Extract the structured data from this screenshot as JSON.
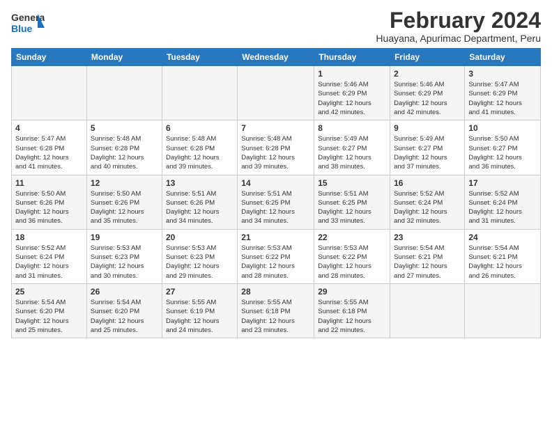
{
  "logo": {
    "line1": "General",
    "line2": "Blue"
  },
  "title": "February 2024",
  "location": "Huayana, Apurimac Department, Peru",
  "days_of_week": [
    "Sunday",
    "Monday",
    "Tuesday",
    "Wednesday",
    "Thursday",
    "Friday",
    "Saturday"
  ],
  "weeks": [
    [
      {
        "day": "",
        "info": ""
      },
      {
        "day": "",
        "info": ""
      },
      {
        "day": "",
        "info": ""
      },
      {
        "day": "",
        "info": ""
      },
      {
        "day": "1",
        "info": "Sunrise: 5:46 AM\nSunset: 6:29 PM\nDaylight: 12 hours\nand 42 minutes."
      },
      {
        "day": "2",
        "info": "Sunrise: 5:46 AM\nSunset: 6:29 PM\nDaylight: 12 hours\nand 42 minutes."
      },
      {
        "day": "3",
        "info": "Sunrise: 5:47 AM\nSunset: 6:29 PM\nDaylight: 12 hours\nand 41 minutes."
      }
    ],
    [
      {
        "day": "4",
        "info": "Sunrise: 5:47 AM\nSunset: 6:28 PM\nDaylight: 12 hours\nand 41 minutes."
      },
      {
        "day": "5",
        "info": "Sunrise: 5:48 AM\nSunset: 6:28 PM\nDaylight: 12 hours\nand 40 minutes."
      },
      {
        "day": "6",
        "info": "Sunrise: 5:48 AM\nSunset: 6:28 PM\nDaylight: 12 hours\nand 39 minutes."
      },
      {
        "day": "7",
        "info": "Sunrise: 5:48 AM\nSunset: 6:28 PM\nDaylight: 12 hours\nand 39 minutes."
      },
      {
        "day": "8",
        "info": "Sunrise: 5:49 AM\nSunset: 6:27 PM\nDaylight: 12 hours\nand 38 minutes."
      },
      {
        "day": "9",
        "info": "Sunrise: 5:49 AM\nSunset: 6:27 PM\nDaylight: 12 hours\nand 37 minutes."
      },
      {
        "day": "10",
        "info": "Sunrise: 5:50 AM\nSunset: 6:27 PM\nDaylight: 12 hours\nand 36 minutes."
      }
    ],
    [
      {
        "day": "11",
        "info": "Sunrise: 5:50 AM\nSunset: 6:26 PM\nDaylight: 12 hours\nand 36 minutes."
      },
      {
        "day": "12",
        "info": "Sunrise: 5:50 AM\nSunset: 6:26 PM\nDaylight: 12 hours\nand 35 minutes."
      },
      {
        "day": "13",
        "info": "Sunrise: 5:51 AM\nSunset: 6:26 PM\nDaylight: 12 hours\nand 34 minutes."
      },
      {
        "day": "14",
        "info": "Sunrise: 5:51 AM\nSunset: 6:25 PM\nDaylight: 12 hours\nand 34 minutes."
      },
      {
        "day": "15",
        "info": "Sunrise: 5:51 AM\nSunset: 6:25 PM\nDaylight: 12 hours\nand 33 minutes."
      },
      {
        "day": "16",
        "info": "Sunrise: 5:52 AM\nSunset: 6:24 PM\nDaylight: 12 hours\nand 32 minutes."
      },
      {
        "day": "17",
        "info": "Sunrise: 5:52 AM\nSunset: 6:24 PM\nDaylight: 12 hours\nand 31 minutes."
      }
    ],
    [
      {
        "day": "18",
        "info": "Sunrise: 5:52 AM\nSunset: 6:24 PM\nDaylight: 12 hours\nand 31 minutes."
      },
      {
        "day": "19",
        "info": "Sunrise: 5:53 AM\nSunset: 6:23 PM\nDaylight: 12 hours\nand 30 minutes."
      },
      {
        "day": "20",
        "info": "Sunrise: 5:53 AM\nSunset: 6:23 PM\nDaylight: 12 hours\nand 29 minutes."
      },
      {
        "day": "21",
        "info": "Sunrise: 5:53 AM\nSunset: 6:22 PM\nDaylight: 12 hours\nand 28 minutes."
      },
      {
        "day": "22",
        "info": "Sunrise: 5:53 AM\nSunset: 6:22 PM\nDaylight: 12 hours\nand 28 minutes."
      },
      {
        "day": "23",
        "info": "Sunrise: 5:54 AM\nSunset: 6:21 PM\nDaylight: 12 hours\nand 27 minutes."
      },
      {
        "day": "24",
        "info": "Sunrise: 5:54 AM\nSunset: 6:21 PM\nDaylight: 12 hours\nand 26 minutes."
      }
    ],
    [
      {
        "day": "25",
        "info": "Sunrise: 5:54 AM\nSunset: 6:20 PM\nDaylight: 12 hours\nand 25 minutes."
      },
      {
        "day": "26",
        "info": "Sunrise: 5:54 AM\nSunset: 6:20 PM\nDaylight: 12 hours\nand 25 minutes."
      },
      {
        "day": "27",
        "info": "Sunrise: 5:55 AM\nSunset: 6:19 PM\nDaylight: 12 hours\nand 24 minutes."
      },
      {
        "day": "28",
        "info": "Sunrise: 5:55 AM\nSunset: 6:18 PM\nDaylight: 12 hours\nand 23 minutes."
      },
      {
        "day": "29",
        "info": "Sunrise: 5:55 AM\nSunset: 6:18 PM\nDaylight: 12 hours\nand 22 minutes."
      },
      {
        "day": "",
        "info": ""
      },
      {
        "day": "",
        "info": ""
      }
    ]
  ]
}
